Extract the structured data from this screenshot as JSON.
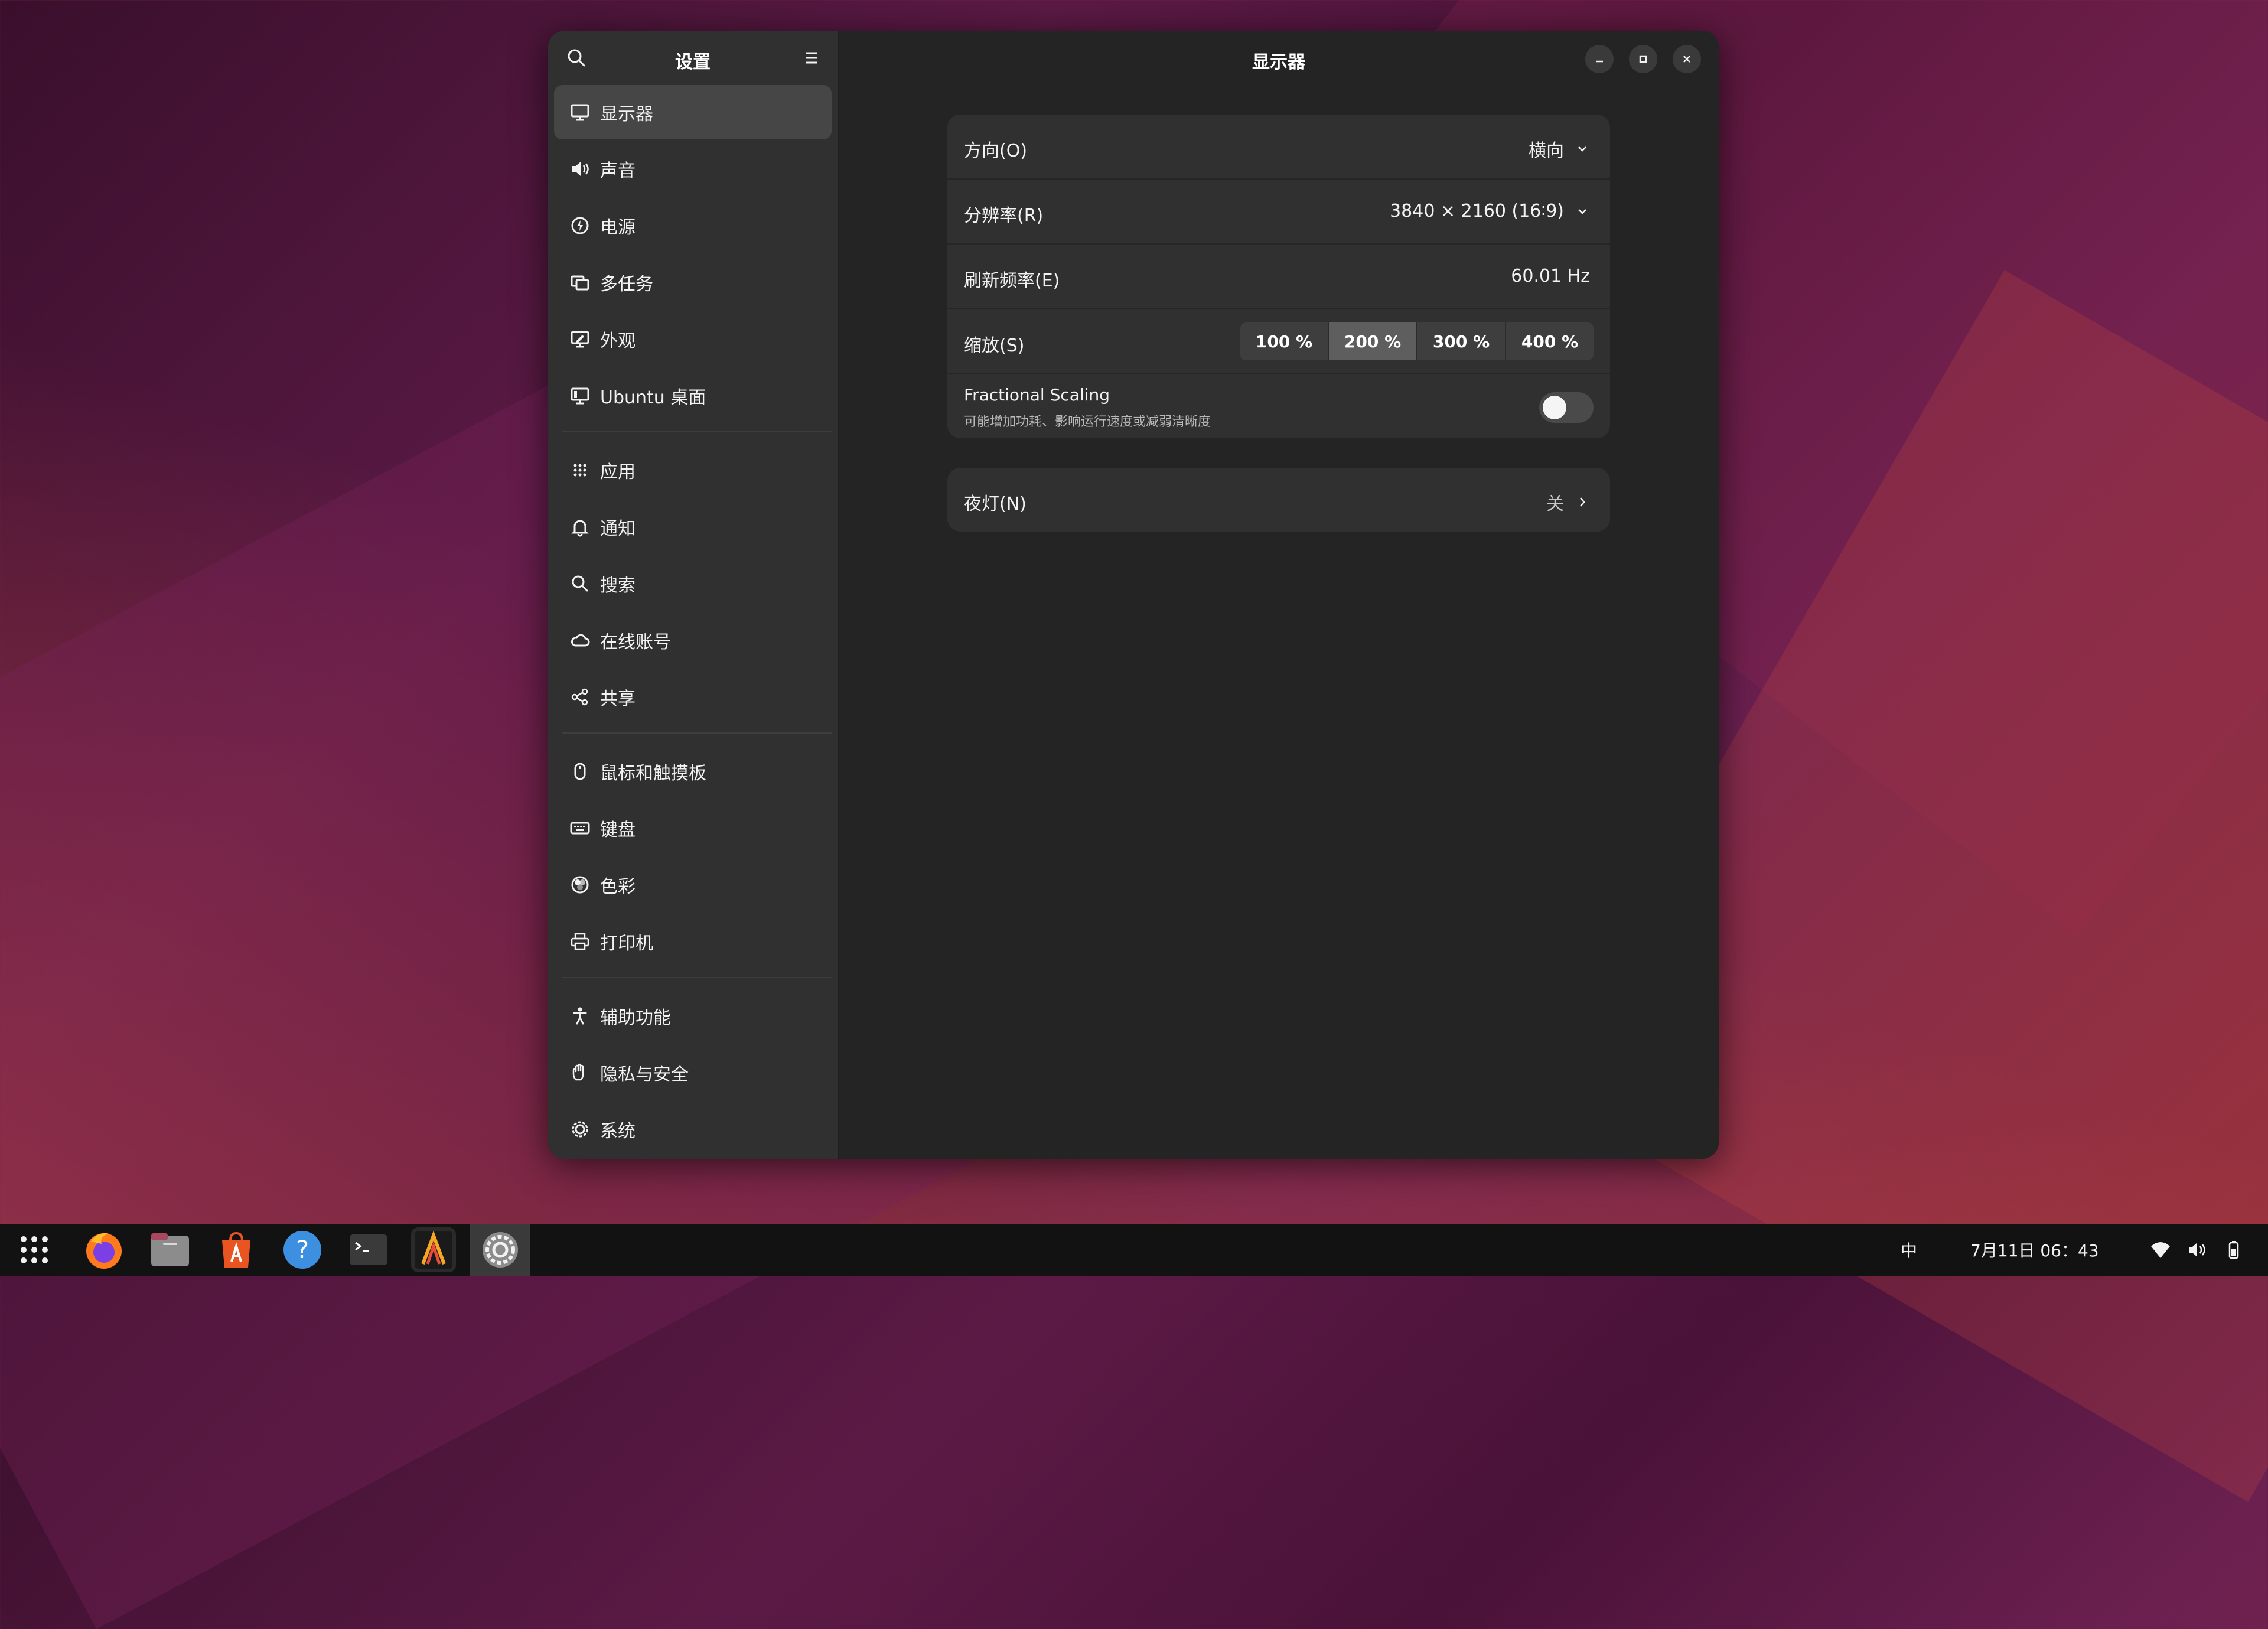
{
  "sidebar": {
    "title": "设置",
    "items": [
      {
        "label": "显示器",
        "icon": "monitor-icon",
        "active": true
      },
      {
        "label": "声音",
        "icon": "speaker-icon"
      },
      {
        "label": "电源",
        "icon": "power-icon"
      },
      {
        "label": "多任务",
        "icon": "multitask-icon"
      },
      {
        "label": "外观",
        "icon": "appearance-icon"
      },
      {
        "label": "Ubuntu 桌面",
        "icon": "ubuntu-desktop-icon"
      },
      {
        "label": "应用",
        "icon": "apps-grid-icon"
      },
      {
        "label": "通知",
        "icon": "bell-icon"
      },
      {
        "label": "搜索",
        "icon": "search-icon"
      },
      {
        "label": "在线账号",
        "icon": "cloud-icon"
      },
      {
        "label": "共享",
        "icon": "share-icon"
      },
      {
        "label": "鼠标和触摸板",
        "icon": "mouse-icon"
      },
      {
        "label": "键盘",
        "icon": "keyboard-icon"
      },
      {
        "label": "色彩",
        "icon": "color-icon"
      },
      {
        "label": "打印机",
        "icon": "printer-icon"
      },
      {
        "label": "辅助功能",
        "icon": "accessibility-icon"
      },
      {
        "label": "隐私与安全",
        "icon": "hand-icon"
      },
      {
        "label": "系统",
        "icon": "system-gear-icon"
      }
    ]
  },
  "main": {
    "title": "显示器",
    "orientation": {
      "label": "方向(O)",
      "value": "横向"
    },
    "resolution": {
      "label": "分辨率(R)",
      "value": "3840 × 2160 (16∶9)"
    },
    "refresh": {
      "label": "刷新频率(E)",
      "value": "60.01 Hz"
    },
    "scale": {
      "label": "缩放(S)",
      "options": [
        "100 %",
        "200 %",
        "300 %",
        "400 %"
      ],
      "selected": "200 %"
    },
    "fractional": {
      "label": "Fractional Scaling",
      "subtitle": "可能增加功耗、影响运行速度或减弱清晰度",
      "enabled": false
    },
    "night_light": {
      "label": "夜灯(N)",
      "value": "关"
    }
  },
  "taskbar": {
    "apps": [
      "apps-grid-icon",
      "firefox-icon",
      "files-icon",
      "app-center-icon",
      "help-icon",
      "terminal-icon",
      "app-launcher-icon",
      "settings-icon"
    ],
    "input_method": "中",
    "clock": "7月11日 06：43"
  }
}
